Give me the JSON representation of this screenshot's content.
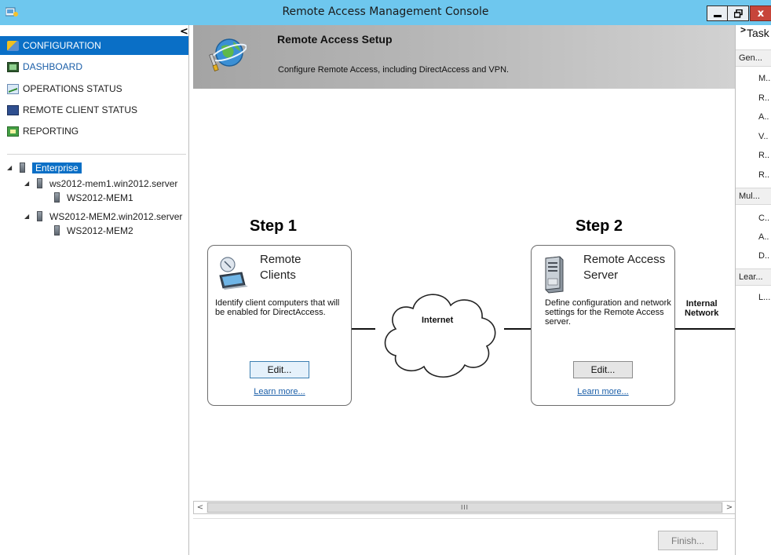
{
  "window": {
    "title": "Remote Access Management Console",
    "controls": {
      "minimize": "▁",
      "maximize": "🗗",
      "close": "x"
    }
  },
  "left_pane": {
    "collapse_glyph": "<",
    "nav": [
      {
        "label": "CONFIGURATION",
        "icon": "configuration-icon",
        "selected": true
      },
      {
        "label": "DASHBOARD",
        "icon": "dashboard-icon"
      },
      {
        "label": "OPERATIONS STATUS",
        "icon": "operations-status-icon"
      },
      {
        "label": "REMOTE CLIENT STATUS",
        "icon": "remote-client-status-icon"
      },
      {
        "label": "REPORTING",
        "icon": "reporting-icon"
      }
    ],
    "tree": {
      "root": "Enterprise",
      "nodes": [
        {
          "label": "ws2012-mem1.win2012.server",
          "child": "WS2012-MEM1"
        },
        {
          "label": "WS2012-MEM2.win2012.server",
          "child": "WS2012-MEM2"
        }
      ]
    }
  },
  "banner": {
    "title": "Remote Access Setup",
    "subtitle": "Configure Remote Access, including DirectAccess and VPN."
  },
  "steps": [
    {
      "title": "Step 1",
      "card_heading_line1": "Remote",
      "card_heading_line2": "Clients",
      "description": "Identify client computers that will be enabled for DirectAccess.",
      "edit_label": "Edit...",
      "learn_more": "Learn more..."
    },
    {
      "title": "Step 2",
      "card_heading_line1": "Remote Access",
      "card_heading_line2": "Server",
      "description": "Define configuration and network settings for the Remote Access server.",
      "edit_label": "Edit...",
      "learn_more": "Learn more..."
    }
  ],
  "diagram": {
    "internet_label": "Internet",
    "internal_label_line1": "Internal",
    "internal_label_line2": "Network"
  },
  "scrollbar": {
    "left": "<",
    "right": ">",
    "grip": "III"
  },
  "finish_label": "Finish...",
  "tasks_pane": {
    "title": "Task",
    "chevron": ">",
    "groups": [
      {
        "label": "Gen...",
        "items": [
          "M..",
          "R..",
          "A..",
          "V..",
          "R..",
          "R.."
        ]
      },
      {
        "label": "Mul...",
        "items": [
          "C..",
          "A..",
          "D.."
        ]
      },
      {
        "label": "Lear...",
        "items": [
          "L..."
        ]
      }
    ]
  },
  "colors": {
    "titlebar": "#6ec7ee",
    "selection": "#0a6fc6",
    "link": "#1a5ea8",
    "close": "#c7453a"
  }
}
